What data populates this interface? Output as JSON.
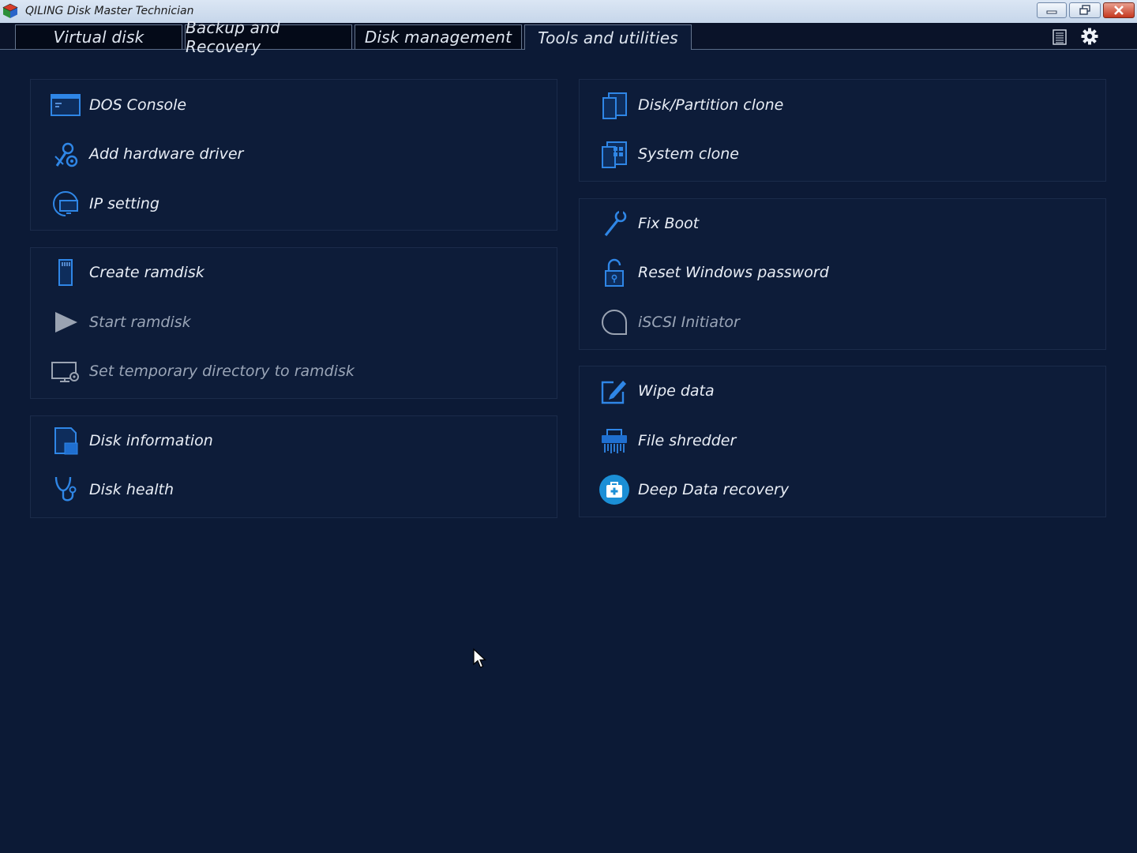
{
  "window": {
    "title": "QILING Disk Master Technician",
    "accent": "#1f7fe8"
  },
  "tabs": [
    {
      "label": "Virtual disk",
      "active": false
    },
    {
      "label": "Backup and Recovery",
      "active": false
    },
    {
      "label": "Disk management",
      "active": false
    },
    {
      "label": "Tools and utilities",
      "active": true
    }
  ],
  "toolbar": {
    "icons": [
      "log-list-icon",
      "gear-icon"
    ]
  },
  "left": {
    "group1": [
      {
        "label": "DOS Console",
        "icon": "console-window-icon",
        "enabled": true
      },
      {
        "label": "Add hardware driver",
        "icon": "wrench-gear-icon",
        "enabled": true
      },
      {
        "label": "IP setting",
        "icon": "network-monitor-icon",
        "enabled": true
      }
    ],
    "group2": [
      {
        "label": "Create ramdisk",
        "icon": "memory-card-icon",
        "enabled": true
      },
      {
        "label": "Start ramdisk",
        "icon": "play-icon",
        "enabled": false
      },
      {
        "label": "Set temporary directory to ramdisk",
        "icon": "monitor-gear-icon",
        "enabled": false
      }
    ],
    "group3": [
      {
        "label": "Disk information",
        "icon": "disk-info-icon",
        "enabled": true
      },
      {
        "label": "Disk health",
        "icon": "stethoscope-icon",
        "enabled": true
      }
    ]
  },
  "right": {
    "group1": [
      {
        "label": "Disk/Partition clone",
        "icon": "copy-pages-icon",
        "enabled": true
      },
      {
        "label": "System clone",
        "icon": "windows-clone-icon",
        "enabled": true
      }
    ],
    "group2": [
      {
        "label": "Fix Boot",
        "icon": "wrench-icon",
        "enabled": true
      },
      {
        "label": "Reset Windows password",
        "icon": "padlock-icon",
        "enabled": true
      },
      {
        "label": "iSCSI Initiator",
        "icon": "iscsi-circle-icon",
        "enabled": false
      }
    ],
    "group3": [
      {
        "label": "Wipe data",
        "icon": "edit-pen-icon",
        "enabled": true
      },
      {
        "label": "File shredder",
        "icon": "shredder-icon",
        "enabled": true
      },
      {
        "label": "Deep Data recovery",
        "icon": "first-aid-icon",
        "enabled": true
      }
    ]
  }
}
